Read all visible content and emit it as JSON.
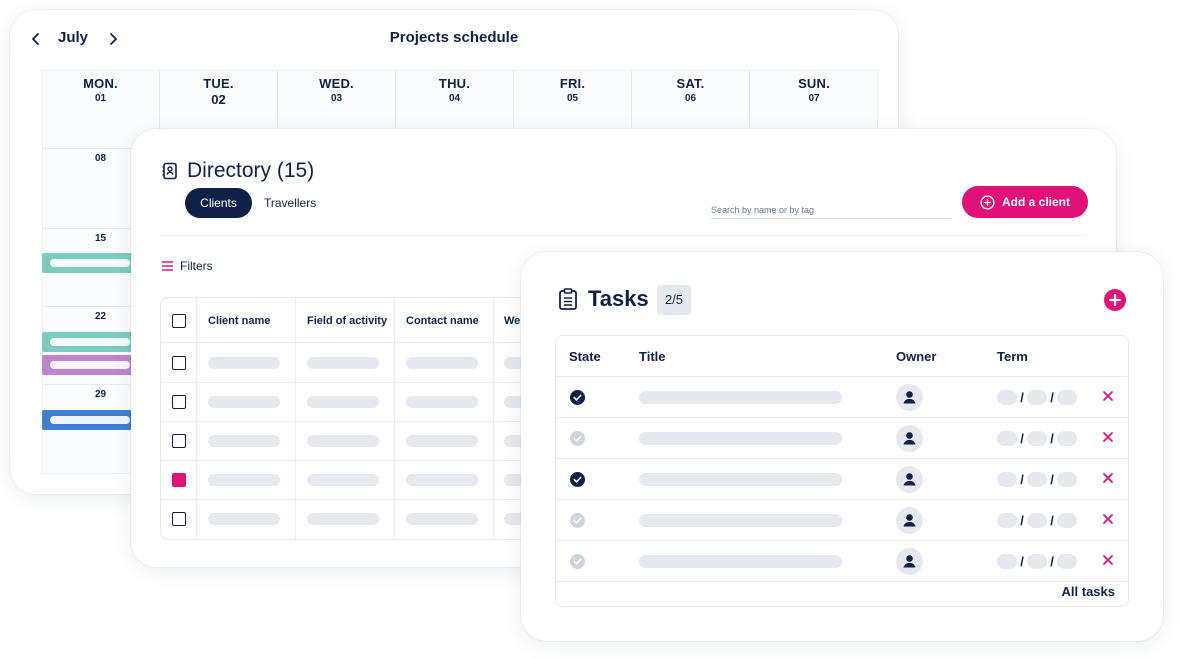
{
  "colors": {
    "navy": "#0f2146",
    "accent": "#e0127a",
    "skeleton": "#e6e8ee"
  },
  "schedule": {
    "month": "July",
    "title": "Projects schedule",
    "days": [
      {
        "name": "MON.",
        "num": "01"
      },
      {
        "name": "TUE.",
        "num": "02"
      },
      {
        "name": "WED.",
        "num": "03"
      },
      {
        "name": "THU.",
        "num": "04"
      },
      {
        "name": "FRI.",
        "num": "05"
      },
      {
        "name": "SAT.",
        "num": "06"
      },
      {
        "name": "SUN.",
        "num": "07"
      }
    ],
    "weeks": [
      "08",
      "15",
      "22",
      "29"
    ],
    "event_colors": [
      "#7dcbbf",
      "#7dcbbf",
      "#c084cf",
      "#3f7fd0"
    ]
  },
  "directory": {
    "title": "Directory (15)",
    "tabs": [
      "Clients",
      "Travellers"
    ],
    "search_placeholder": "Search by name or by tag",
    "add_label": "Add a client",
    "filters_label": "Filters",
    "columns": [
      "Client name",
      "Field of activity",
      "Contact name",
      "We"
    ],
    "row_checked": [
      false,
      false,
      false,
      true,
      false
    ]
  },
  "tasks": {
    "title": "Tasks",
    "count": "2/5",
    "columns": [
      "State",
      "Title",
      "Owner",
      "Term"
    ],
    "row_done": [
      true,
      false,
      true,
      false,
      false
    ],
    "term_sep": "/",
    "all_label": "All tasks"
  }
}
